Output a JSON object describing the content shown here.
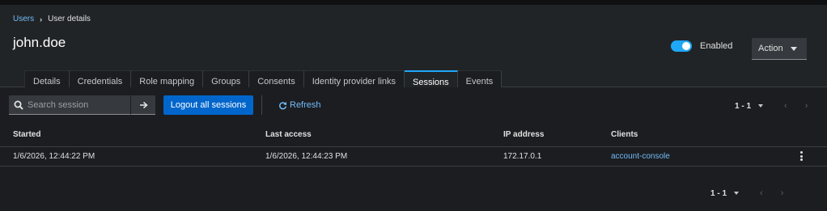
{
  "breadcrumb": {
    "parent": "Users",
    "current": "User details"
  },
  "page": {
    "title": "john.doe"
  },
  "enabled_toggle": {
    "label": "Enabled",
    "on": true
  },
  "action_menu": {
    "label": "Action"
  },
  "tabs": [
    {
      "label": "Details",
      "active": false
    },
    {
      "label": "Credentials",
      "active": false
    },
    {
      "label": "Role mapping",
      "active": false
    },
    {
      "label": "Groups",
      "active": false
    },
    {
      "label": "Consents",
      "active": false
    },
    {
      "label": "Identity provider links",
      "active": false
    },
    {
      "label": "Sessions",
      "active": true
    },
    {
      "label": "Events",
      "active": false
    }
  ],
  "toolbar": {
    "search_placeholder": "Search session",
    "logout_label": "Logout all sessions",
    "refresh_label": "Refresh"
  },
  "pagination_top": {
    "range": "1 - 1",
    "prev": "‹",
    "next": "›"
  },
  "pagination_bottom": {
    "range": "1 - 1",
    "prev": "‹",
    "next": "›"
  },
  "table": {
    "headers": {
      "started": "Started",
      "last_access": "Last access",
      "ip": "IP address",
      "clients": "Clients"
    },
    "rows": [
      {
        "started": "1/6/2026, 12:44:22 PM",
        "last_access": "1/6/2026, 12:44:23 PM",
        "ip": "172.17.0.1",
        "client": "account-console"
      }
    ]
  },
  "colors": {
    "accent": "#0066cc",
    "link": "#73bcf7",
    "toggle": "#1fa7f8",
    "background": "#1b1d21"
  },
  "icons": {
    "search": "search-icon",
    "go": "arrow-right-icon",
    "refresh": "refresh-icon",
    "row_menu": "kebab-icon"
  }
}
